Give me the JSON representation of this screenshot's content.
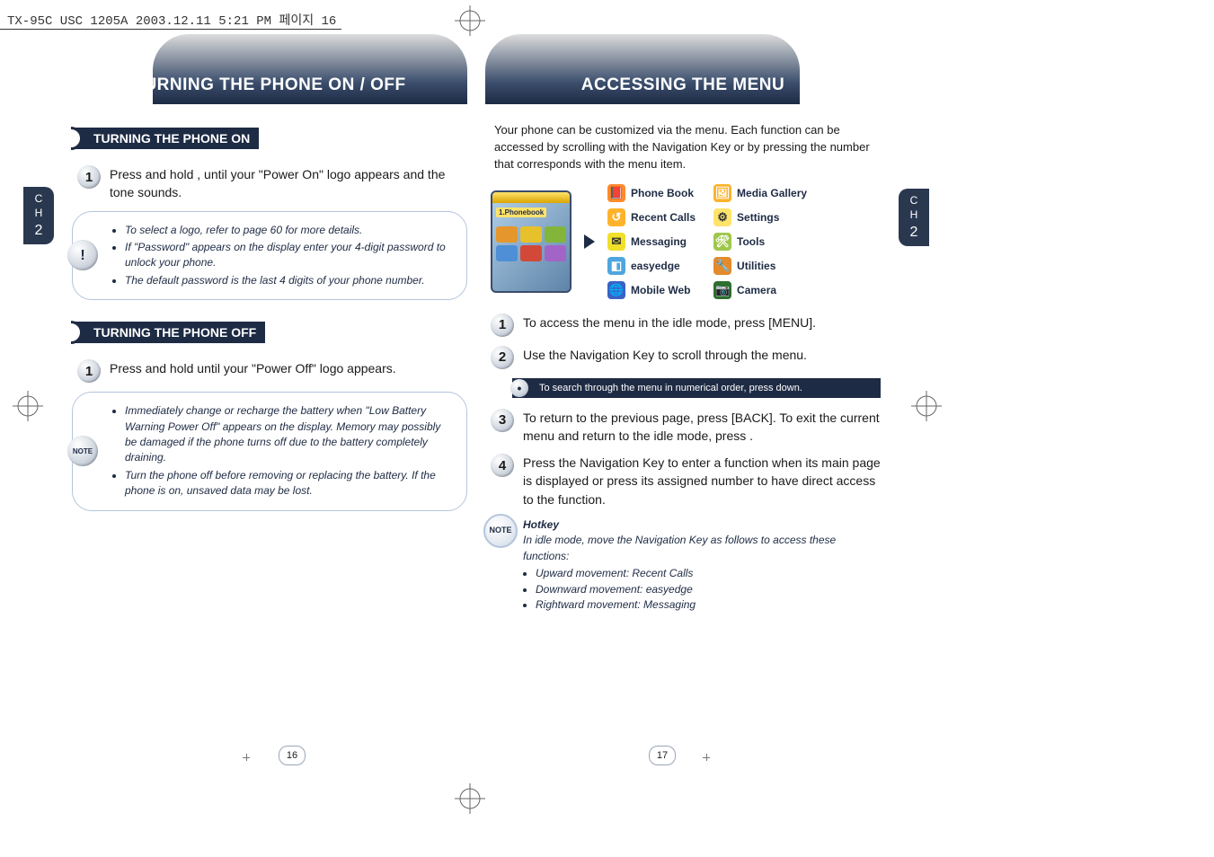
{
  "header_meta": "TX-95C USC 1205A  2003.12.11 5:21 PM  페이지 16",
  "chapter": {
    "label_line1": "C",
    "label_line2": "H",
    "number": "2"
  },
  "left_page": {
    "banner": "TURNING THE PHONE ON / OFF",
    "section_on": "TURNING THE PHONE ON",
    "on_step1": "Press and hold       , until your \"Power On\" logo appears and the tone sounds.",
    "on_tips": [
      "To select a logo, refer to page 60 for more details.",
      "If \"Password\" appears on the display enter your 4-digit password to unlock your phone.",
      "The default password is the last 4 digits of your phone number."
    ],
    "tip_badge": "!",
    "section_off": "TURNING THE PHONE OFF",
    "off_step1": "Press and hold       until your \"Power Off\" logo appears.",
    "off_tips": [
      "Immediately change or recharge the battery when \"Low Battery Warning Power Off\" appears on the display. Memory may possibly be damaged if the phone turns off due to the battery completely draining.",
      "Turn the phone off before removing or replacing the battery. If the phone is on, unsaved data may be lost."
    ],
    "note_badge": "NOTE",
    "page_number": "16"
  },
  "right_page": {
    "banner": "ACCESSING THE MENU",
    "intro": "Your phone can be customized via the menu. Each function can be accessed by scrolling with the Navigation Key or by pressing the number that corresponds with the menu item.",
    "phone_highlight": "1.Phonebook",
    "menu_left": [
      "Phone Book",
      "Recent Calls",
      "Messaging",
      "easyedge",
      "Mobile Web"
    ],
    "menu_right": [
      "Media Gallery",
      "Settings",
      "Tools",
      "Utilities",
      "Camera"
    ],
    "step1": "To access the menu in the idle mode, press       [MENU].",
    "step2": "Use the Navigation Key to scroll through the menu.",
    "tip": "To search through the menu in numerical order, press down.",
    "step3": "To return to the previous page, press        [BACK]. To exit the current menu and return to the idle mode, press       .",
    "step4": "Press the Navigation Key to enter a function when its main page is displayed or press its assigned number to have direct access to the function.",
    "note_title": "Hotkey",
    "note_intro": "In idle mode, move the Navigation Key as follows to access these functions:",
    "note_items": [
      "Upward movement: Recent Calls",
      "Downward movement: easyedge",
      "Rightward movement: Messaging"
    ],
    "note_badge": "NOTE",
    "page_number": "17"
  },
  "icons": {
    "phone_book": {
      "bg": "#ff8a2b",
      "glyph": "📕"
    },
    "recent_calls": {
      "bg": "#ffb32b",
      "glyph": "↺"
    },
    "messaging": {
      "bg": "#f0e02a",
      "glyph": "✉"
    },
    "easyedge": {
      "bg": "#4ea6e0",
      "glyph": "◧"
    },
    "mobile_web": {
      "bg": "#3a62c3",
      "glyph": "🌐"
    },
    "media_gallery": {
      "bg": "#ffb32b",
      "glyph": "🖼"
    },
    "settings": {
      "bg": "#ffe36b",
      "glyph": "⚙"
    },
    "tools": {
      "bg": "#9fc74c",
      "glyph": "🛠"
    },
    "utilities": {
      "bg": "#e38a2b",
      "glyph": "🔧"
    },
    "camera": {
      "bg": "#2e6f2e",
      "glyph": "📷"
    }
  }
}
